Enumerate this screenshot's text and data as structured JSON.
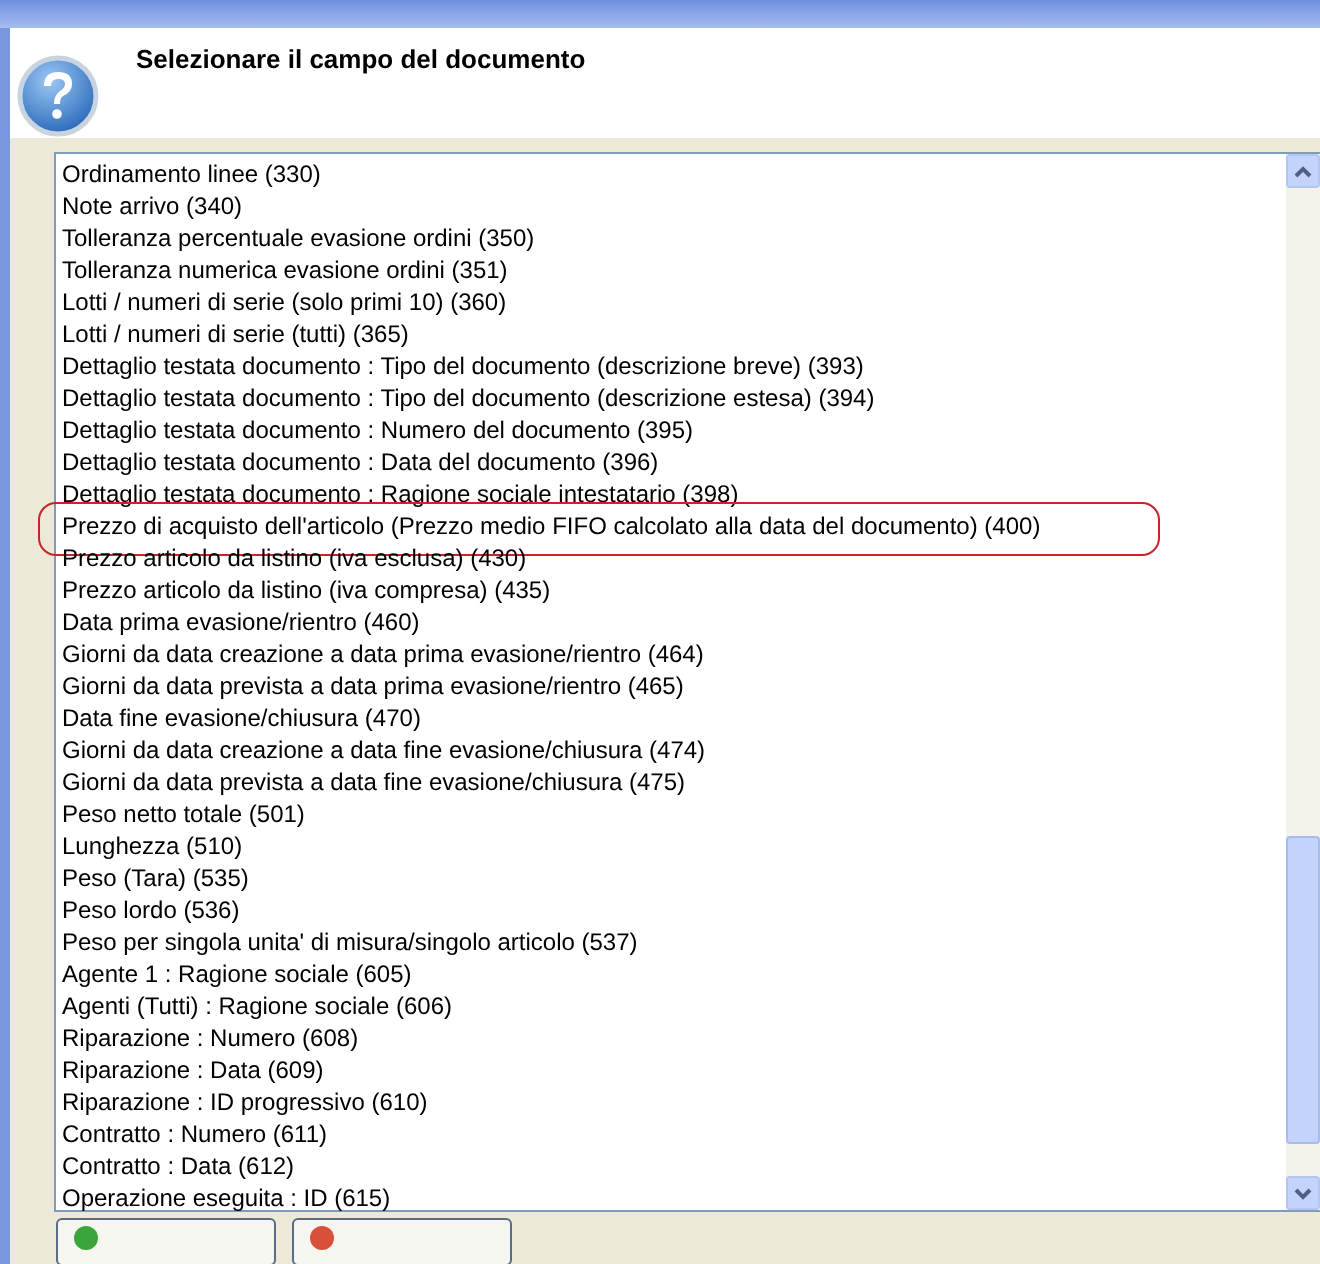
{
  "dialog": {
    "heading": "Selezionare il campo del documento"
  },
  "fields": [
    {
      "label": "Ordinamento linee (330)",
      "highlighted": false
    },
    {
      "label": "Note arrivo (340)",
      "highlighted": false
    },
    {
      "label": "Tolleranza percentuale evasione ordini (350)",
      "highlighted": false
    },
    {
      "label": "Tolleranza numerica evasione ordini (351)",
      "highlighted": false
    },
    {
      "label": "Lotti / numeri di serie (solo primi 10) (360)",
      "highlighted": false
    },
    {
      "label": "Lotti / numeri di serie (tutti) (365)",
      "highlighted": false
    },
    {
      "label": "Dettaglio testata documento : Tipo del documento (descrizione breve) (393)",
      "highlighted": false
    },
    {
      "label": "Dettaglio testata documento : Tipo del documento (descrizione estesa) (394)",
      "highlighted": false
    },
    {
      "label": "Dettaglio testata documento : Numero del documento (395)",
      "highlighted": false
    },
    {
      "label": "Dettaglio testata documento : Data del documento (396)",
      "highlighted": false
    },
    {
      "label": "Dettaglio testata documento : Ragione sociale intestatario (398)",
      "highlighted": false
    },
    {
      "label": "Prezzo di acquisto dell'articolo (Prezzo medio FIFO calcolato alla data del documento) (400)",
      "highlighted": true
    },
    {
      "label": "Prezzo articolo da listino (iva esclusa) (430)",
      "highlighted": false
    },
    {
      "label": "Prezzo articolo da listino (iva compresa) (435)",
      "highlighted": false
    },
    {
      "label": "Data prima evasione/rientro (460)",
      "highlighted": false
    },
    {
      "label": "Giorni da data creazione a data prima evasione/rientro (464)",
      "highlighted": false
    },
    {
      "label": "Giorni da data prevista a data prima evasione/rientro (465)",
      "highlighted": false
    },
    {
      "label": "Data fine evasione/chiusura (470)",
      "highlighted": false
    },
    {
      "label": "Giorni da data creazione a data fine evasione/chiusura (474)",
      "highlighted": false
    },
    {
      "label": "Giorni da data prevista a data fine evasione/chiusura (475)",
      "highlighted": false
    },
    {
      "label": "Peso netto totale (501)",
      "highlighted": false
    },
    {
      "label": "Lunghezza (510)",
      "highlighted": false
    },
    {
      "label": "Peso (Tara) (535)",
      "highlighted": false
    },
    {
      "label": "Peso lordo (536)",
      "highlighted": false
    },
    {
      "label": "Peso per singola unita' di misura/singolo articolo (537)",
      "highlighted": false
    },
    {
      "label": "Agente 1 : Ragione sociale (605)",
      "highlighted": false
    },
    {
      "label": "Agenti (Tutti) : Ragione sociale (606)",
      "highlighted": false
    },
    {
      "label": "Riparazione : Numero (608)",
      "highlighted": false
    },
    {
      "label": "Riparazione : Data (609)",
      "highlighted": false
    },
    {
      "label": "Riparazione : ID progressivo (610)",
      "highlighted": false
    },
    {
      "label": "Contratto : Numero (611)",
      "highlighted": false
    },
    {
      "label": "Contratto : Data (612)",
      "highlighted": false
    },
    {
      "label": "Operazione eseguita : ID (615)",
      "highlighted": false
    }
  ],
  "buttons": [
    {
      "kind": "confirm"
    },
    {
      "kind": "cancel"
    }
  ]
}
